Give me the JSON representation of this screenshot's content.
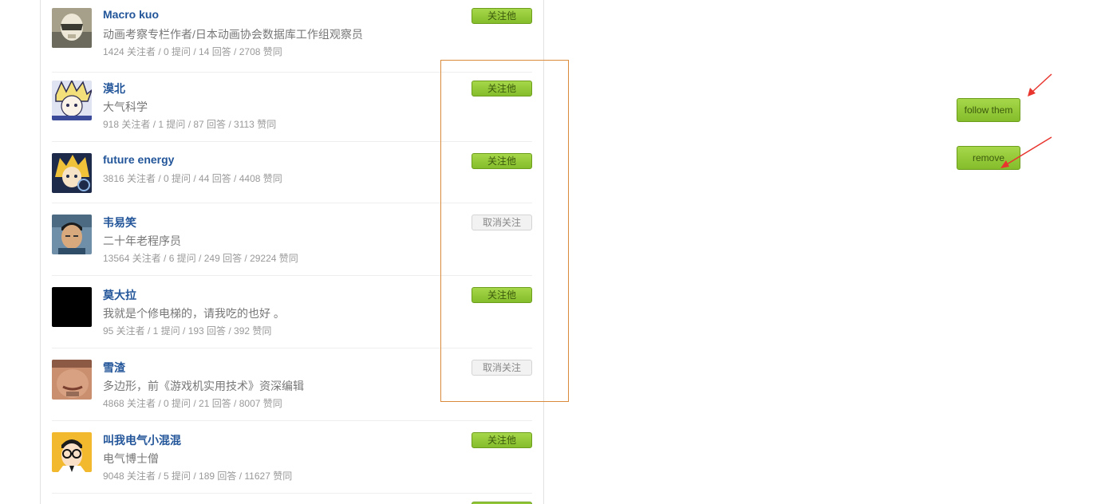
{
  "users": [
    {
      "name": "Macro kuo",
      "bio": "动画考察专栏作者/日本动画协会数据库工作组观察员",
      "stats": "1424 关注者 / 0 提问 / 14 回答 / 2708 赞同",
      "button": "关注他"
    },
    {
      "name": "漠北",
      "bio": "大气科学",
      "stats": "918 关注者 / 1 提问 / 87 回答 / 3113 赞同",
      "button": "关注他"
    },
    {
      "name": "future energy",
      "bio": "",
      "stats": "3816 关注者 / 0 提问 / 44 回答 / 4408 赞同",
      "button": "关注他"
    },
    {
      "name": "韦易笑",
      "bio": "二十年老程序员",
      "stats": "13564 关注者 / 6 提问 / 249 回答 / 29224 赞同",
      "button": "取消关注"
    },
    {
      "name": "莫大拉",
      "bio": "我就是个修电梯的，请我吃的也好 。",
      "stats": "95 关注者 / 1 提问 / 193 回答 / 392 赞同",
      "button": "关注他"
    },
    {
      "name": "雪渣",
      "bio": "多边形，前《游戏机实用技术》资深编辑",
      "stats": "4868 关注者 / 0 提问 / 21 回答 / 8007 赞同",
      "button": "取消关注"
    },
    {
      "name": "叫我电气小混混",
      "bio": "电气博士僧",
      "stats": "9048 关注者 / 5 提问 / 189 回答 / 11627 赞同",
      "button": "关注他"
    }
  ],
  "legend": {
    "follow_label": "follow them",
    "remove_label": "remove"
  },
  "colors": {
    "follow_green": "#8cc63f",
    "name_blue": "#225599",
    "highlight_orange": "#d98a3a",
    "arrow_red": "#e8352e"
  }
}
